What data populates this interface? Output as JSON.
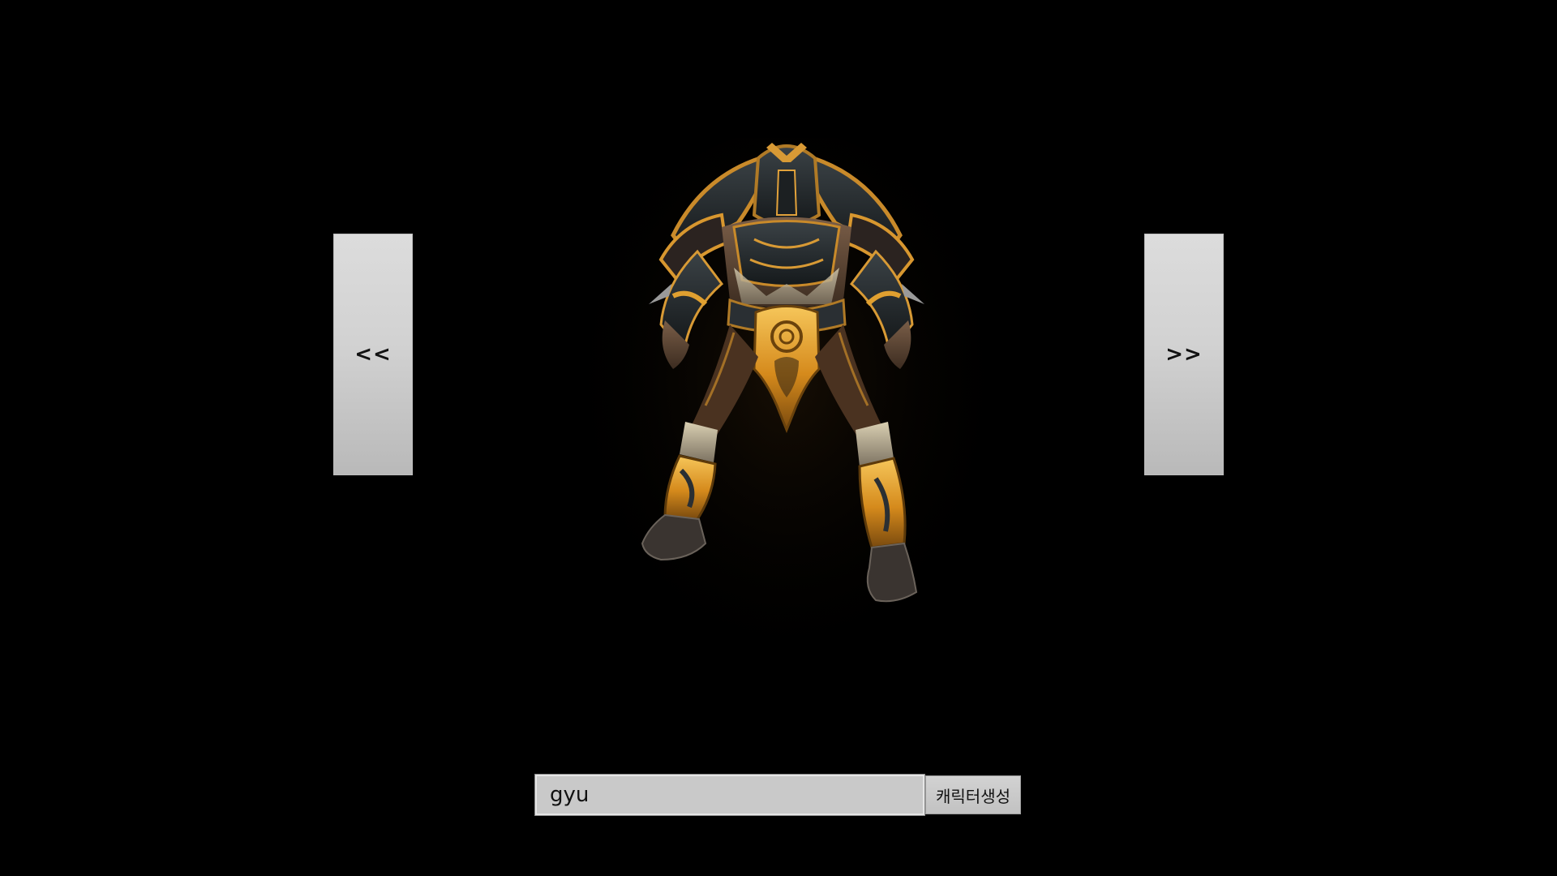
{
  "navigation": {
    "prev_label": "<<",
    "next_label": ">>"
  },
  "character": {
    "icon": "armored-warrior-figure"
  },
  "form": {
    "name_value": "gyu",
    "create_label": "캐릭터생성"
  },
  "colors": {
    "background": "#000000",
    "button_face": "#d2d2d2",
    "input_face": "#c9c9c9",
    "armor_gold": "#e0a030"
  }
}
